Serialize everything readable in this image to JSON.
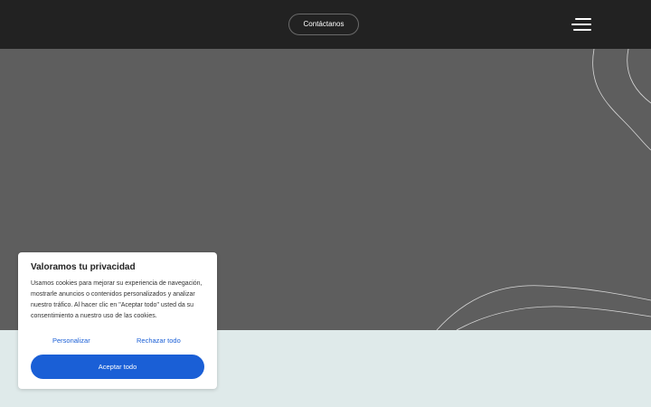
{
  "header": {
    "contact_label": "Contáctanos",
    "menu_icon": "hamburger-menu-icon"
  },
  "cookie_banner": {
    "title": "Valoramos tu privacidad",
    "body": "Usamos cookies para mejorar su experiencia de navegación, mostrarle anuncios o contenidos personalizados y analizar nuestro tráfico. Al hacer clic en \"Aceptar todo\" usted da su consentimiento a nuestro uso de las cookies.",
    "customize_label": "Personalizar",
    "reject_label": "Rechazar todo",
    "accept_label": "Aceptar todo"
  },
  "colors": {
    "header_bg": "#222222",
    "hero_bg": "#5e5e5e",
    "lower_bg": "#dfeaea",
    "accent": "#1a5fd6"
  }
}
